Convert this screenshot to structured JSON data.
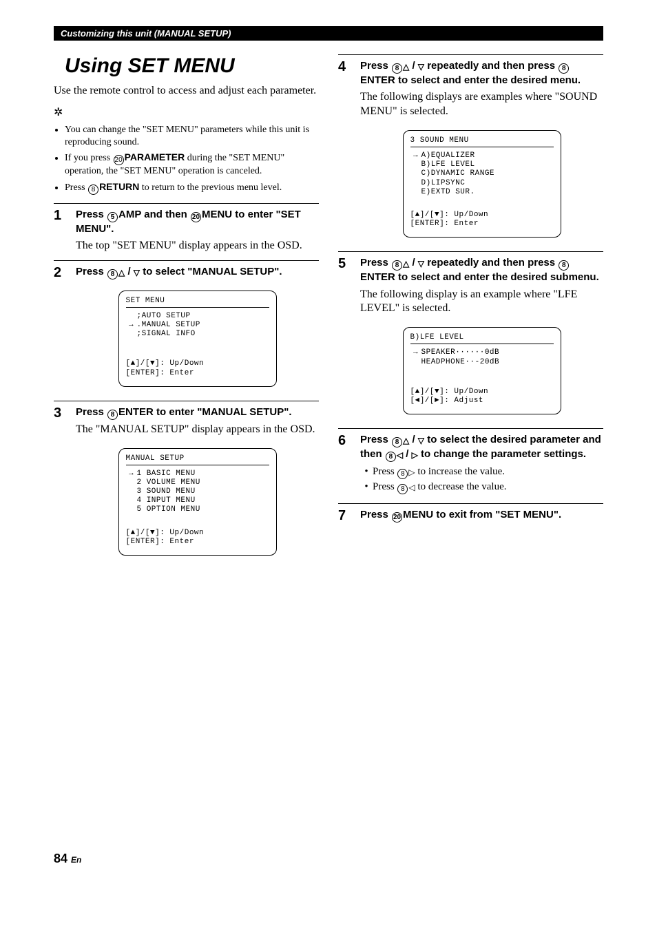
{
  "header_bar": "Customizing this unit (MANUAL SETUP)",
  "title": "Using SET MENU",
  "intro": "Use the remote control to access and adjust each parameter.",
  "notes": [
    "You can change the \"SET MENU\" parameters while this unit is reproducing sound.",
    "If you press ⑳PARAMETER during the \"SET MENU\" operation, the \"SET MENU\" operation is canceled.",
    "Press ⑧RETURN to return to the previous menu level."
  ],
  "note_bullets": {
    "n1": "You can change the \"SET MENU\" parameters while this unit is reproducing sound.",
    "n2_pre": "If you press ",
    "n2_btn_num": "⑳",
    "n2_btn_label": "PARAMETER",
    "n2_post": " during the \"SET MENU\" operation, the \"SET MENU\" operation is canceled.",
    "n3_pre": "Press ",
    "n3_btn_num": "⑧",
    "n3_btn_label": "RETURN",
    "n3_post": " to return to the previous menu level."
  },
  "steps": {
    "s1": {
      "num": "1",
      "head_pre": "Press ",
      "b1_num": "⑤",
      "b1_label": "AMP",
      "mid": " and then ",
      "b2_num": "⑳",
      "b2_label": "MENU",
      "head_post": " to enter \"SET MENU\".",
      "desc": "The top \"SET MENU\" display appears in the OSD."
    },
    "s2": {
      "num": "2",
      "head_pre": "Press ",
      "b_num": "⑧",
      "head_post": " to select \"MANUAL SETUP\".",
      "osd_title": " SET MENU",
      "osd_lines": [
        ";AUTO SETUP",
        ".MANUAL SETUP",
        ";SIGNAL INFO"
      ],
      "osd_arrow_row": 1,
      "osd_hints": "[▲]/[▼]: Up/Down\n[ENTER]: Enter"
    },
    "s3": {
      "num": "3",
      "head_pre": "Press ",
      "b_num": "⑧",
      "b_label": "ENTER",
      "head_post": " to enter \"MANUAL SETUP\".",
      "desc": "The \"MANUAL SETUP\" display appears in the OSD.",
      "osd_title": " MANUAL SETUP",
      "osd_lines": [
        "1 BASIC MENU",
        "2 VOLUME MENU",
        "3 SOUND MENU",
        "4 INPUT MENU",
        "5 OPTION MENU"
      ],
      "osd_arrow_row": 0,
      "osd_hints": "[▲]/[▼]: Up/Down\n[ENTER]: Enter"
    },
    "s4": {
      "num": "4",
      "head_pre": "Press ",
      "b1_num": "⑧",
      "mid1": " repeatedly and then press ",
      "b2_num": "⑧",
      "b2_label": "ENTER",
      "head_post": " to select and enter the desired menu.",
      "desc": "The following displays are examples where \"SOUND MENU\" is selected.",
      "osd_title": " 3 SOUND MENU",
      "osd_lines": [
        "A)EQUALIZER",
        "B)LFE LEVEL",
        "C)DYNAMIC RANGE",
        "D)LIPSYNC",
        "E)EXTD SUR."
      ],
      "osd_arrow_row": 0,
      "osd_hints": "[▲]/[▼]: Up/Down\n[ENTER]: Enter"
    },
    "s5": {
      "num": "5",
      "head_pre": "Press ",
      "b1_num": "⑧",
      "mid1": " repeatedly and then press ",
      "b2_num": "⑧",
      "b2_label": "ENTER",
      "head_post": " to select and enter the desired submenu.",
      "desc": "The following display is an example where \"LFE LEVEL\" is selected.",
      "osd_title": " B)LFE LEVEL",
      "osd_lines": [
        "SPEAKER······0dB",
        "HEADPHONE··-20dB"
      ],
      "osd_arrow_row": 0,
      "osd_hints": "[▲]/[▼]: Up/Down\n[◄]/[►]: Adjust"
    },
    "s6": {
      "num": "6",
      "head_pre": "Press ",
      "b1_num": "⑧",
      "mid1": " to select the desired parameter and then ",
      "b2_num": "⑧",
      "head_post": " to change the parameter settings.",
      "sub1_pre": "Press ",
      "sub1_num": "⑧",
      "sub1_post": " to increase the value.",
      "sub2_pre": "Press ",
      "sub2_num": "⑧",
      "sub2_post": " to decrease the value."
    },
    "s7": {
      "num": "7",
      "head_pre": "Press ",
      "b_num": "⑳",
      "b_label": "MENU",
      "head_post": " to exit from \"SET MENU\"."
    }
  },
  "page_number": "84",
  "page_lang": "En"
}
